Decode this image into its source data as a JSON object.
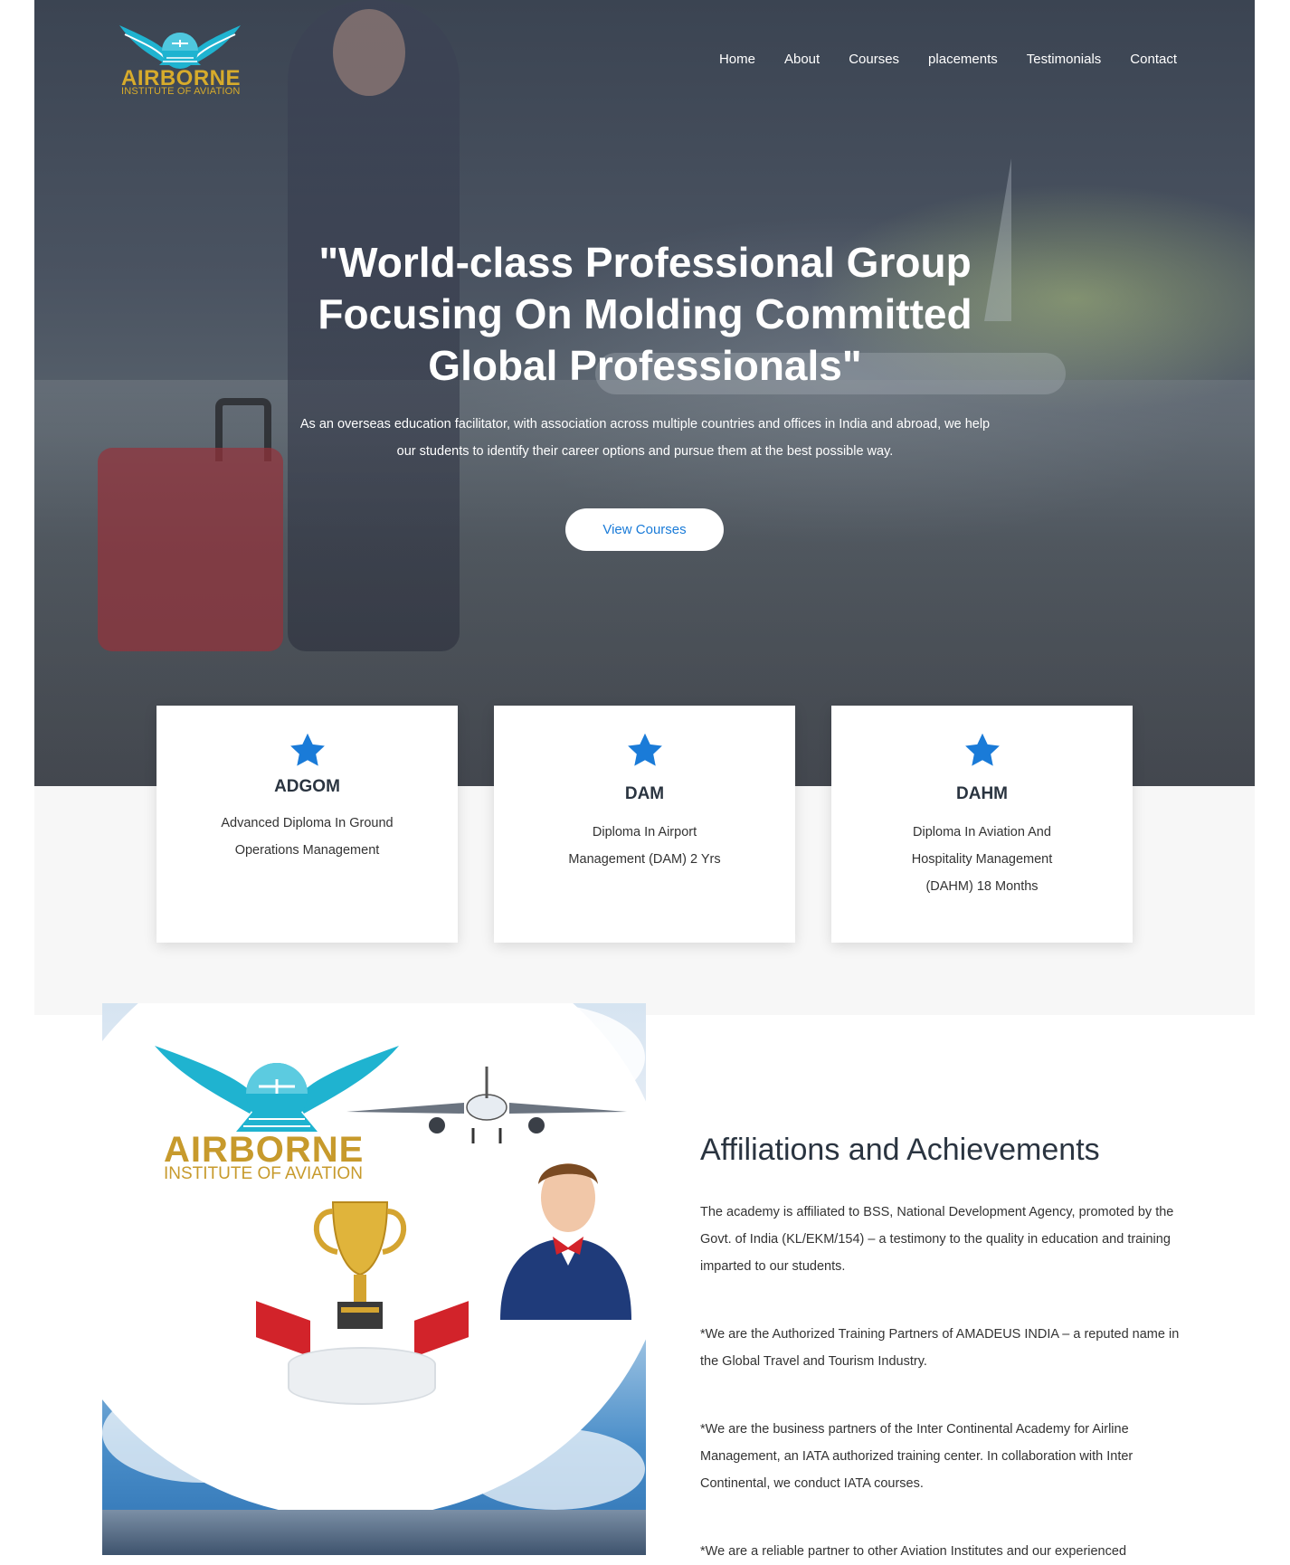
{
  "brand": {
    "name": "AIRBORNE",
    "tagline": "INSTITUTE OF AVIATION",
    "colors": {
      "gold": "#d7ab2b",
      "teal": "#1fb3d0",
      "accent": "#1a7bd8",
      "text": "#2a3440"
    }
  },
  "nav": {
    "items": [
      {
        "label": "Home"
      },
      {
        "label": "About"
      },
      {
        "label": "Courses"
      },
      {
        "label": "placements"
      },
      {
        "label": "Testimonials"
      },
      {
        "label": "Contact"
      }
    ]
  },
  "hero": {
    "title": "\"World-class Professional Group Focusing On Molding Committed Global Professionals\"",
    "description": "As an overseas education facilitator, with association across multiple countries and offices in India and abroad, we help our students to identify their career options and pursue them at the best possible way.",
    "cta_label": "View Courses"
  },
  "courses": [
    {
      "icon": "star-icon",
      "code": "ADGOM",
      "description": "Advanced Diploma In Ground Operations Management"
    },
    {
      "icon": "star-icon",
      "code": "DAM",
      "description": "Diploma In Airport Management (DAM) 2 Yrs"
    },
    {
      "icon": "star-icon",
      "code": "DAHM",
      "description": "Diploma In Aviation And Hospitality Management (DAHM) 18 Months"
    }
  ],
  "poster": {
    "name": "AIRBORNE",
    "tagline": "INSTITUTE OF AVIATION"
  },
  "affiliations": {
    "title": "Affiliations and Achievements",
    "paragraphs": [
      "The academy is affiliated to BSS, National Development Agency, promoted by the Govt. of India (KL/EKM/154) – a testimony to the quality in education and training imparted to our students.",
      "*We are the Authorized Training Partners of AMADEUS INDIA – a reputed name in the Global Travel and Tourism Industry.",
      "*We are the business partners of the Inter Continental Academy for Airline Management, an IATA authorized training center. In collaboration with Inter Continental, we conduct IATA courses.",
      "*We are a reliable partner to other Aviation Institutes and our experienced"
    ]
  }
}
